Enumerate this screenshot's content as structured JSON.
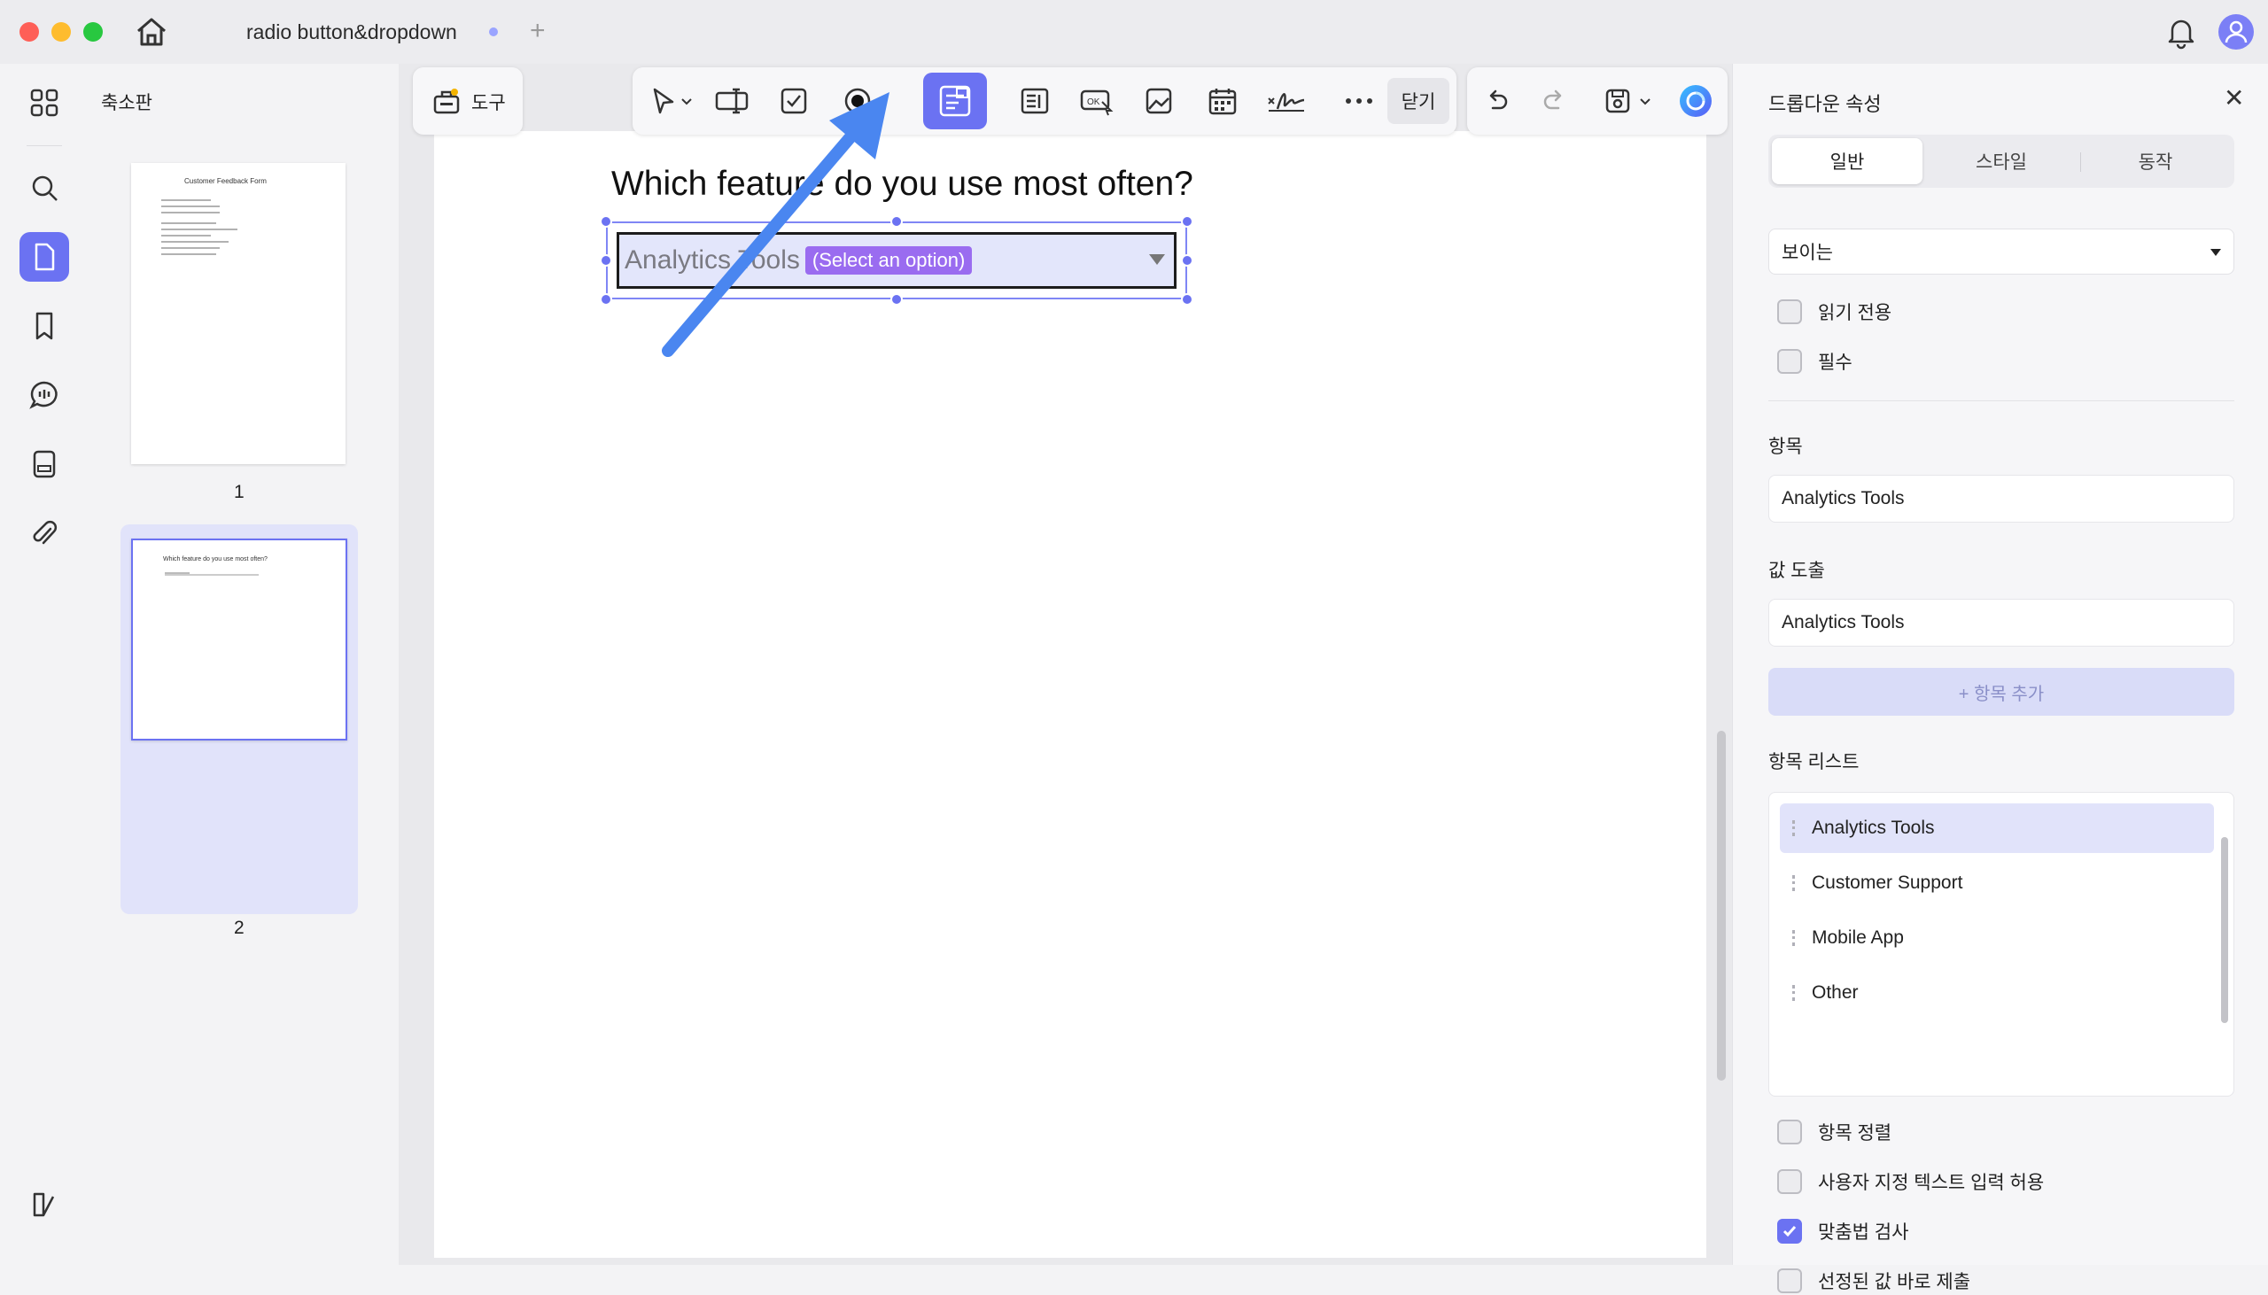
{
  "window": {
    "tab_title": "radio button&dropdown",
    "new_tab": "+"
  },
  "thumbnails": {
    "title": "축소판",
    "pages": [
      {
        "number": "1",
        "title": "Customer Feedback Form"
      },
      {
        "number": "2",
        "title": "Which feature do you use most often?"
      }
    ]
  },
  "toolbar": {
    "tools_label": "도구",
    "close_label": "닫기",
    "icons": [
      "pointer-icon",
      "text-field-icon",
      "checkbox-tool-icon",
      "radio-button-tool-icon",
      "dropdown-tool-icon",
      "list-box-tool-icon",
      "button-tool-icon",
      "image-tool-icon",
      "date-tool-icon",
      "signature-tool-icon",
      "more-icon"
    ]
  },
  "document": {
    "question": "Which feature do you use most often?",
    "dropdown": {
      "value": "Analytics Tools",
      "hint": "(Select an option)"
    }
  },
  "properties": {
    "title": "드롭다운 속성",
    "tabs": [
      "일반",
      "스타일",
      "동작"
    ],
    "active_tab": "일반",
    "visibility": "보이는",
    "readonly_label": "읽기 전용",
    "required_label": "필수",
    "item_section": "항목",
    "item_value": "Analytics Tools",
    "export_section": "값 도출",
    "export_value": "Analytics Tools",
    "add_item": "+ 항목 추가",
    "list_section": "항목 리스트",
    "list_items": [
      "Analytics Tools",
      "Customer Support",
      "Mobile App",
      "Other"
    ],
    "selected_item": "Analytics Tools",
    "options": [
      {
        "label": "항목 정렬",
        "checked": false
      },
      {
        "label": "사용자 지정 텍스트 입력 허용",
        "checked": false
      },
      {
        "label": "맞춤법 검사",
        "checked": true
      },
      {
        "label": "선정된 값 바로 제출",
        "checked": false
      }
    ]
  },
  "colors": {
    "accent": "#6b72f2",
    "annotation_arrow": "#4a86f0",
    "hint_badge": "#9a6cf0"
  }
}
